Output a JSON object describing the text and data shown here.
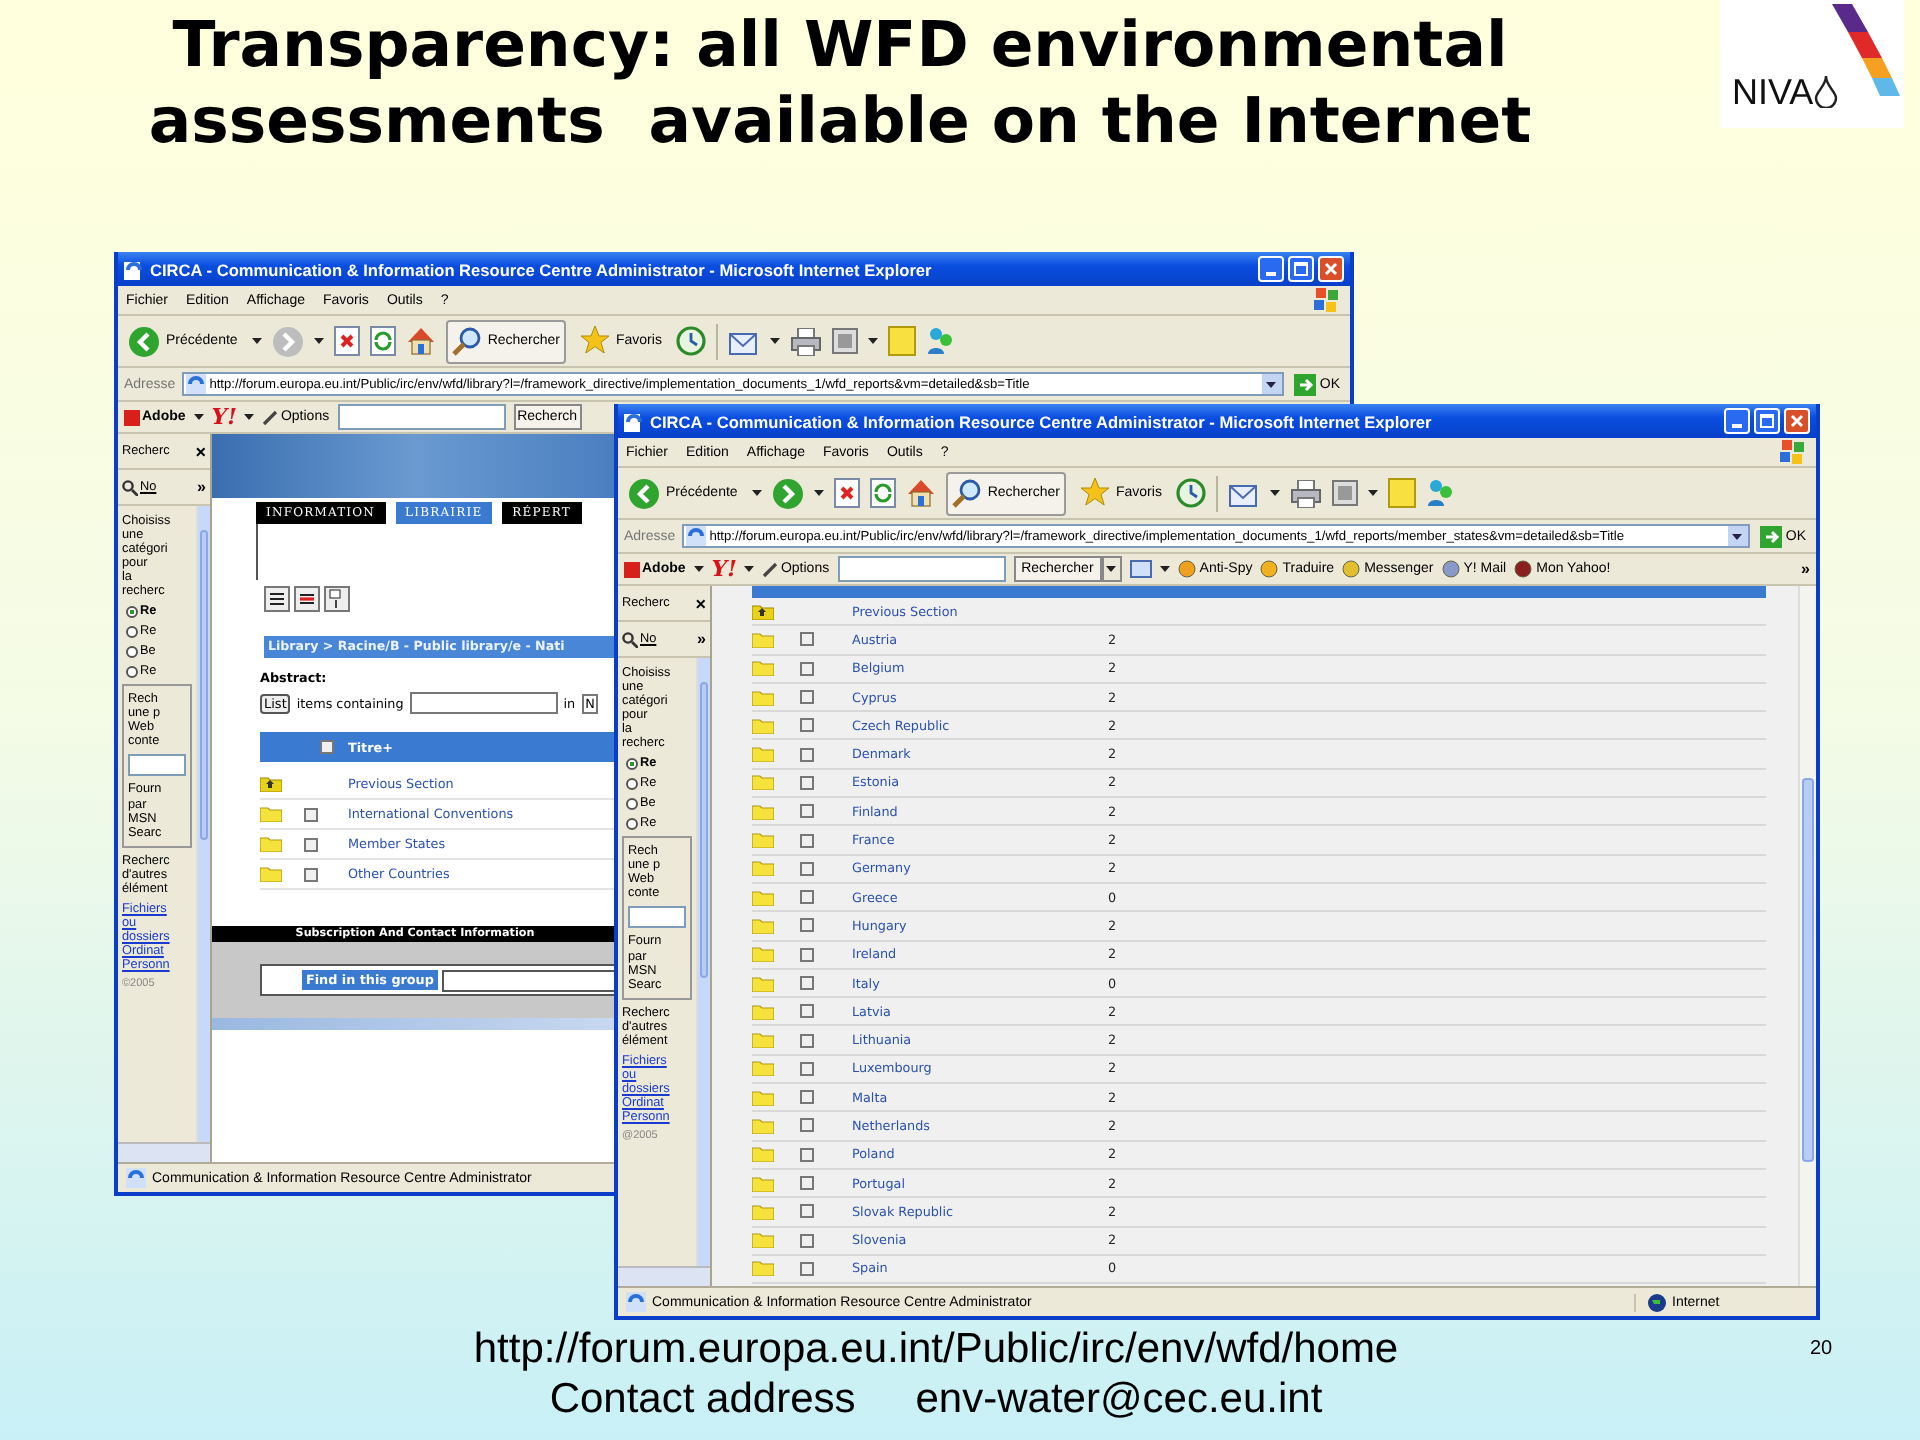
{
  "slide": {
    "title_lines": [
      "Transparency: all WFD environmental",
      "assessments  available on the Internet"
    ],
    "logo": "NIVA",
    "page_number": "20",
    "url": "http://forum.europa.eu.int/Public/irc/env/wfd/home",
    "contact_label": "Contact address",
    "contact_email": "env-water@cec.eu.int"
  },
  "windows": [
    {
      "title": "CIRCA - Communication & Information Resource Centre Administrator - Microsoft Internet Explorer",
      "menu": [
        "Fichier",
        "Edition",
        "Affichage",
        "Favoris",
        "Outils",
        "?"
      ],
      "back_label": "Précédente",
      "forward_disabled": true,
      "search_label": "Rechercher",
      "favorites_label": "Favoris",
      "address_label": "Adresse",
      "address": "http://forum.europa.eu.int/Public/irc/env/wfd/library?l=/framework_directive/implementation_documents_1/wfd_reports&vm=detailed&sb=Title",
      "go_label": "OK",
      "yahoo_bar": {
        "adobe": "Adobe",
        "yahoo": "Y!",
        "options": "Options",
        "search_button": "Recherch"
      },
      "sidebar": {
        "header": "Recherc",
        "close": "×",
        "link": "No",
        "more": "»",
        "prompt_lines": [
          "Choisiss",
          "une",
          "catégori",
          "pour",
          "la",
          "recherc"
        ],
        "radios": [
          {
            "label": "Re",
            "selected": true
          },
          {
            "label": "Re",
            "selected": false
          },
          {
            "label": "Be",
            "selected": false
          },
          {
            "label": "Re",
            "selected": false
          }
        ],
        "box_lines": [
          "Rech",
          "une p",
          "Web",
          "conte"
        ],
        "provider_lines": [
          "Fourn",
          "par",
          "MSN",
          "Searc"
        ],
        "other_lines": [
          "Recherc",
          "d'autres",
          "élément"
        ],
        "link_lines": [
          "Fichiers",
          "ou",
          "dossiers",
          "Ordinat",
          "Personn"
        ],
        "copyright": "©2005"
      },
      "page": {
        "tabs": [
          {
            "label": "INFORMATION",
            "selected": false
          },
          {
            "label": "LIBRAIRIE",
            "selected": true
          },
          {
            "label": "RÉPERT",
            "selected": false
          }
        ],
        "breadcrumb": "Library > Racine/B - Public library/e - Nati",
        "abstract": "Abstract:",
        "list_button": "List",
        "items_label": "items containing",
        "in_label": "in",
        "select_value": "N",
        "column": "Titre+",
        "header_checked": false,
        "rows": [
          {
            "kind": "up",
            "name": "Previous Section"
          },
          {
            "kind": "folder",
            "name": "International Conventions",
            "checked": false
          },
          {
            "kind": "folder",
            "name": "Member States",
            "checked": false
          },
          {
            "kind": "folder",
            "name": "Other Countries",
            "checked": false
          }
        ],
        "subscription": "Subscription And Contact Information",
        "find_label": "Find in this group"
      },
      "status": "Communication & Information Resource Centre Administrator"
    },
    {
      "title": "CIRCA - Communication & Information Resource Centre Administrator - Microsoft Internet Explorer",
      "menu": [
        "Fichier",
        "Edition",
        "Affichage",
        "Favoris",
        "Outils",
        "?"
      ],
      "back_label": "Précédente",
      "forward_disabled": false,
      "search_label": "Rechercher",
      "favorites_label": "Favoris",
      "address_label": "Adresse",
      "address": "http://forum.europa.eu.int/Public/irc/env/wfd/library?l=/framework_directive/implementation_documents_1/wfd_reports/member_states&vm=detailed&sb=Title",
      "go_label": "OK",
      "yahoo_bar": {
        "adobe": "Adobe",
        "yahoo": "Y!",
        "options": "Options",
        "search_button": "Rechercher",
        "items": [
          "Anti-Spy",
          "Traduire",
          "Messenger",
          "Y! Mail",
          "Mon Yahoo!"
        ],
        "more": "»"
      },
      "sidebar": {
        "header": "Recherc",
        "close": "×",
        "link": "No",
        "more": "»",
        "prompt_lines": [
          "Choisiss",
          "une",
          "catégori",
          "pour",
          "la",
          "recherc"
        ],
        "radios": [
          {
            "label": "Re",
            "selected": true
          },
          {
            "label": "Re",
            "selected": false
          },
          {
            "label": "Be",
            "selected": false
          },
          {
            "label": "Re",
            "selected": false
          }
        ],
        "box_lines": [
          "Rech",
          "une p",
          "Web",
          "conte"
        ],
        "provider_lines": [
          "Fourn",
          "par",
          "MSN",
          "Searc"
        ],
        "other_lines": [
          "Recherc",
          "d'autres",
          "élément"
        ],
        "link_lines": [
          "Fichiers",
          "ou",
          "dossiers",
          "Ordinat",
          "Personn"
        ],
        "copyright": "@2005"
      },
      "page": {
        "rows": [
          {
            "kind": "up",
            "name": "Previous Section"
          },
          {
            "kind": "folder",
            "name": "Austria",
            "count": "2",
            "checked": false
          },
          {
            "kind": "folder",
            "name": "Belgium",
            "count": "2",
            "checked": false
          },
          {
            "kind": "folder",
            "name": "Cyprus",
            "count": "2",
            "checked": false
          },
          {
            "kind": "folder",
            "name": "Czech Republic",
            "count": "2",
            "checked": false
          },
          {
            "kind": "folder",
            "name": "Denmark",
            "count": "2",
            "checked": false
          },
          {
            "kind": "folder",
            "name": "Estonia",
            "count": "2",
            "checked": false
          },
          {
            "kind": "folder",
            "name": "Finland",
            "count": "2",
            "checked": false
          },
          {
            "kind": "folder",
            "name": "France",
            "count": "2",
            "checked": false
          },
          {
            "kind": "folder",
            "name": "Germany",
            "count": "2",
            "checked": false
          },
          {
            "kind": "folder",
            "name": "Greece",
            "count": "0",
            "checked": false
          },
          {
            "kind": "folder",
            "name": "Hungary",
            "count": "2",
            "checked": false
          },
          {
            "kind": "folder",
            "name": "Ireland",
            "count": "2",
            "checked": false
          },
          {
            "kind": "folder",
            "name": "Italy",
            "count": "0",
            "checked": false
          },
          {
            "kind": "folder",
            "name": "Latvia",
            "count": "2",
            "checked": false
          },
          {
            "kind": "folder",
            "name": "Lithuania",
            "count": "2",
            "checked": false
          },
          {
            "kind": "folder",
            "name": "Luxembourg",
            "count": "2",
            "checked": false
          },
          {
            "kind": "folder",
            "name": "Malta",
            "count": "2",
            "checked": false
          },
          {
            "kind": "folder",
            "name": "Netherlands",
            "count": "2",
            "checked": false
          },
          {
            "kind": "folder",
            "name": "Poland",
            "count": "2",
            "checked": false
          },
          {
            "kind": "folder",
            "name": "Portugal",
            "count": "2",
            "checked": false
          },
          {
            "kind": "folder",
            "name": "Slovak Republic",
            "count": "2",
            "checked": false
          },
          {
            "kind": "folder",
            "name": "Slovenia",
            "count": "2",
            "checked": false
          },
          {
            "kind": "folder",
            "name": "Spain",
            "count": "0",
            "checked": false
          }
        ]
      },
      "status": "Communication & Information Resource Centre Administrator",
      "zone": "Internet"
    }
  ]
}
